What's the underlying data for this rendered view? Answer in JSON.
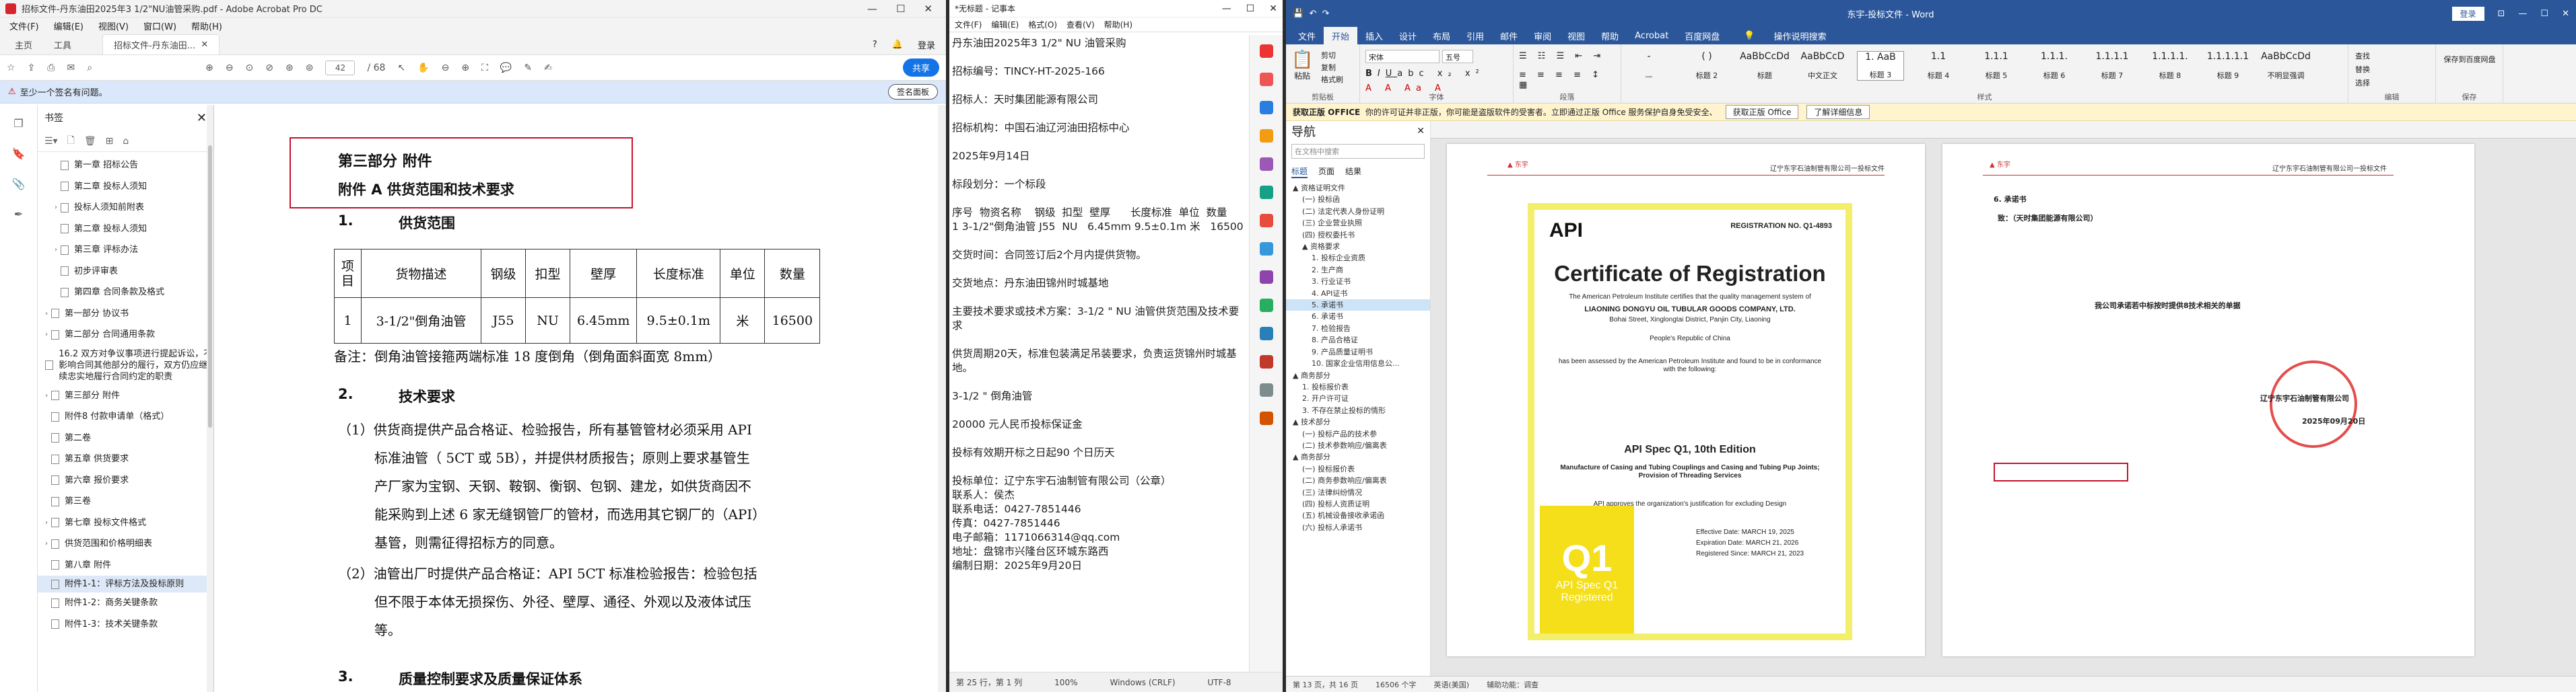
{
  "acrobat": {
    "title": "招标文件-丹东油田2025年3 1/2\"NU油管采购.pdf - Adobe Acrobat Pro DC",
    "menu": [
      "文件(F)",
      "编辑(E)",
      "视图(V)",
      "窗口(W)",
      "帮助(H)"
    ],
    "tabs": {
      "home": "主页",
      "tools": "工具",
      "doc": "招标文件-丹东油田...",
      "login": "登录"
    },
    "toolbar": {
      "page": "42",
      "total": "/ 68",
      "share": "共享"
    },
    "sigbar": {
      "text": "至少一个签名有问题。",
      "button": "签名面板"
    },
    "bookmarks_title": "书签",
    "bookmarks": [
      {
        "label": "第一章  招标公告",
        "level": 1,
        "sel": false
      },
      {
        "label": "第二章  投标人须知",
        "level": 1,
        "sel": false
      },
      {
        "label": "投标人须知前附表",
        "level": 1,
        "sel": false,
        "arrow": true
      },
      {
        "label": "第二章  投标人须知",
        "level": 1,
        "sel": false
      },
      {
        "label": "第三章  评标办法",
        "level": 1,
        "sel": false,
        "arrow": true
      },
      {
        "label": "初步评审表",
        "level": 1,
        "sel": false
      },
      {
        "label": "第四章  合同条款及格式",
        "level": 1,
        "sel": false
      },
      {
        "label": "第一部分 协议书",
        "level": 0,
        "sel": false,
        "arrow": true
      },
      {
        "label": "第二部分 合同通用条款",
        "level": 0,
        "sel": false,
        "arrow": true
      },
      {
        "label": "16.2 双方对争议事项进行提起诉讼，不影响合同其他部分的履行，双方仍应继续忠实地履行合同约定的职责",
        "level": 0,
        "sel": false,
        "multi": true
      },
      {
        "label": "第三部分 附件",
        "level": 0,
        "sel": false,
        "arrow": true
      },
      {
        "label": "附件8 付款申请单（格式）",
        "level": 0,
        "sel": false
      },
      {
        "label": "第二卷",
        "level": 0,
        "sel": false
      },
      {
        "label": "第五章  供货要求",
        "level": 0,
        "sel": false
      },
      {
        "label": "第六章  报价要求",
        "level": 0,
        "sel": false
      },
      {
        "label": "第三卷",
        "level": 0,
        "sel": false
      },
      {
        "label": "第七章  投标文件格式",
        "level": 0,
        "sel": false,
        "arrow": true
      },
      {
        "label": "供货范围和价格明细表",
        "level": 0,
        "sel": false,
        "arrow": true
      },
      {
        "label": "第八章  附件",
        "level": 0,
        "sel": false
      },
      {
        "label": "附件1-1：评标方法及投标原则",
        "level": 0,
        "sel": true,
        "multi": true
      },
      {
        "label": "附件1-2：商务关键条款",
        "level": 0,
        "sel": false
      },
      {
        "label": "附件1-3：技术关键条款",
        "level": 0,
        "sel": false
      }
    ],
    "doc": {
      "part": "第三部分  附件",
      "annex": "附件 A  供货范围和技术要求",
      "s1": {
        "num": "1.",
        "title": "供货范围"
      },
      "table": {
        "header": [
          "项目",
          "货物描述",
          "钢级",
          "扣型",
          "壁厚",
          "长度标准",
          "单位",
          "数量"
        ],
        "row": [
          "1",
          "3-1/2\"倒角油管",
          "J55",
          "NU",
          "6.45mm",
          "9.5±0.1m",
          "米",
          "16500"
        ]
      },
      "note": "备注：倒角油管接箍两端标准 18 度倒角（倒角面斜面宽 8mm）",
      "s2": {
        "num": "2.",
        "title": "技术要求"
      },
      "p1a": "（1）供货商提供产品合格证、检验报告，所有基管管材必须采用 API",
      "p1b": "标准油管（  5CT 或 5B），并提供材质报告；原则上要求基管生",
      "p1c": "产厂家为宝钢、天钢、鞍钢、衡钢、包钢、建龙，如供货商因不",
      "p1d": "能采购到上述 6 家无缝钢管厂的管材，而选用其它钢厂的（API）",
      "p1e": "基管，则需征得招标方的同意。",
      "p2a": "（2）油管出厂时提供产品合格证：API 5CT 标准检验报告：检验包括",
      "p2b": "但不限于本体无损探伤、外径、壁厚、通径、外观以及液体试压",
      "p2c": "等。",
      "s3": {
        "num": "3.",
        "title": "质量控制要求及质量保证体系"
      }
    }
  },
  "notepad": {
    "title": "*无标题 - 记事本",
    "menu": [
      "文件(F)",
      "编辑(E)",
      "格式(O)",
      "查看(V)",
      "帮助(H)"
    ],
    "text": "丹东油田2025年3 1/2\" NU 油管采购\n\n招标编号：TINCY-HT-2025-166\n\n招标人：天时集团能源有限公司\n\n招标机构：中国石油辽河油田招标中心\n\n2025年9月14日\n\n标段划分：一个标段\n\n序号  物资名称    钢级  扣型  壁厚      长度标准  单位  数量\n1 3-1/2\"倒角油管 J55  NU   6.45mm 9.5±0.1m 米   16500\n\n交货时间：合同签订后2个月内提供货物。\n\n交货地点：丹东油田锦州时城基地\n\n主要技术要求或技术方案：3-1/2 \" NU 油管供货范围及技术要求\n\n供货周期20天，标准包装满足吊装要求，负责运货锦州时城基地。\n\n3-1/2 \" 倒角油管\n\n20000 元人民币投标保证金\n\n投标有效期开标之日起90 个日历天\n\n投标单位：辽宁东宇石油制管有限公司（公章）\n联系人：侯杰\n联系电话：0427-7851446\n传真：0427-7851446\n电子邮箱：1171066314@qq.com\n地址：盘锦市兴隆台区环城东路西\n编制日期：2025年9月20日",
    "status": [
      "第 25 行，第 1 列",
      "100%",
      "Windows (CRLF)",
      "UTF-8"
    ]
  },
  "word": {
    "title": "东宇-投标文件 - Word",
    "login": "登录",
    "tabs": [
      "文件",
      "开始",
      "插入",
      "设计",
      "布局",
      "引用",
      "邮件",
      "审阅",
      "视图",
      "帮助",
      "Acrobat",
      "百度网盘",
      "操作说明搜索"
    ],
    "ribbon": {
      "paste": "粘贴",
      "cut": "剪切",
      "copy": "复制",
      "format": "格式刷",
      "clipboard": "剪贴板",
      "font_name": "宋体",
      "font_size": "五号",
      "font": "字体",
      "paragraph": "段落",
      "styles_group": "样式",
      "styles": [
        {
          "pv": "-",
          "lbl": "—"
        },
        {
          "pv": "( )",
          "lbl": "标题 2"
        },
        {
          "pv": "AaBbCcDd",
          "lbl": "标题"
        },
        {
          "pv": "AaBbCcD",
          "lbl": "中文正文"
        },
        {
          "pv": "1. AaB",
          "lbl": "标题 3"
        },
        {
          "pv": "1.1",
          "lbl": "标题 4"
        },
        {
          "pv": "1.1.1",
          "lbl": "标题 5"
        },
        {
          "pv": "1.1.1.",
          "lbl": "标题 6"
        },
        {
          "pv": "1.1.1.1",
          "lbl": "标题 7"
        },
        {
          "pv": "1.1.1.1.",
          "lbl": "标题 8"
        },
        {
          "pv": "1.1.1.1.1",
          "lbl": "标题 9"
        },
        {
          "pv": "AaBbCcDd",
          "lbl": "不明显强调"
        }
      ],
      "find": "查找",
      "replace": "替换",
      "select": "选择",
      "edit": "编辑",
      "baidu": "保存到百度网盘",
      "save": "保存"
    },
    "info": {
      "label": "获取正版 OFFICE",
      "text": "你的许可证并非正版，你可能是盗版软件的受害者。立即通过正版 Office 服务保护自身免受安全、",
      "btn1": "获取正版 Office",
      "btn2": "了解详细信息"
    },
    "nav": {
      "title": "导航",
      "search": "在文档中搜索",
      "tabs": [
        "标题",
        "页面",
        "结果"
      ],
      "items": [
        {
          "t": "▲ 资格证明文件",
          "i": 0
        },
        {
          "t": "(一) 投标函",
          "i": 1
        },
        {
          "t": "(二) 法定代表人身份证明",
          "i": 1
        },
        {
          "t": "(三) 企业营业执照",
          "i": 1
        },
        {
          "t": "(四) 授权委托书",
          "i": 1
        },
        {
          "t": "▲ 资格要求",
          "i": 1
        },
        {
          "t": "1. 投标企业资质",
          "i": 2
        },
        {
          "t": "2. 生产商",
          "i": 2
        },
        {
          "t": "3. 行业证书",
          "i": 2
        },
        {
          "t": "4. API证书",
          "i": 2
        },
        {
          "t": "5. 承诺书",
          "i": 2,
          "sel": true
        },
        {
          "t": "6. 承诺书",
          "i": 2
        },
        {
          "t": "7. 检验报告",
          "i": 2
        },
        {
          "t": "8. 产品合格证",
          "i": 2
        },
        {
          "t": "9. 产品质量证明书",
          "i": 2
        },
        {
          "t": "10. 国家企业信用信息公...",
          "i": 2
        },
        {
          "t": "▲ 商务部分",
          "i": 0
        },
        {
          "t": "1. 投标报价表",
          "i": 1
        },
        {
          "t": "2. 开户许可证",
          "i": 1
        },
        {
          "t": "3. 不存在禁止投标的情形",
          "i": 1
        },
        {
          "t": "▲ 技术部分",
          "i": 0
        },
        {
          "t": "(一) 投标产品的技术参",
          "i": 1
        },
        {
          "t": "(二) 技术参数响应/偏离表",
          "i": 1
        },
        {
          "t": "▲ 商务部分",
          "i": 0
        },
        {
          "t": "(一) 投标报价表",
          "i": 1
        },
        {
          "t": "(二) 商务参数响应/偏离表",
          "i": 1
        },
        {
          "t": "(三) 法律纠纷情况",
          "i": 1
        },
        {
          "t": "(四) 投标人资质证明",
          "i": 1
        },
        {
          "t": "(五) 机械设备接收承诺函",
          "i": 1
        },
        {
          "t": "(六) 投标人承诺书",
          "i": 1
        }
      ]
    },
    "page1": {
      "company": "辽宁东宇石油制管有限公司一投标文件",
      "regno": "REGISTRATION NO. Q1-4893",
      "api": "API",
      "cert_title": "Certificate of Registration",
      "l1": "The American Petroleum Institute certifies that the quality management system of",
      "l2": "LIAONING DONGYU OIL TUBULAR GOODS COMPANY, LTD.",
      "l3": "Bohai Street, Xinglongtai District, Panjin City, Liaoning",
      "l4": "People's Republic of China",
      "l5": "has been assessed by the American Petroleum Institute and found to be in conformance with the following:",
      "spec": "API Spec Q1, 10th Edition",
      "l6": "Manufacture of Casing and Tubing Couplings and Casing and Tubing Pup Joints; Provision of Threading Services",
      "l7": "API approves the organization's justification for excluding Design",
      "eff": "Effective Date:  MARCH 19, 2025",
      "exp": "Expiration Date: MARCH 21, 2026",
      "regs": "Registered Since: MARCH 21, 2023",
      "q1": "Q1",
      "q1b": "API Spec Q1 Registered"
    },
    "page2": {
      "company": "辽宁东宇石油制管有限公司一投标文件",
      "h": "6. 承诺书",
      "to": "致：（天时集团能源有限公司）",
      "body": "我公司承诺若中标按时提供8技术相关的单据",
      "sign": "辽宁东宇石油制管有限公司",
      "date": "2025年09月20日"
    },
    "status": [
      "第 13 页，共 16 页",
      "16506 个字",
      "英语(美国)",
      "辅助功能：调查"
    ]
  }
}
